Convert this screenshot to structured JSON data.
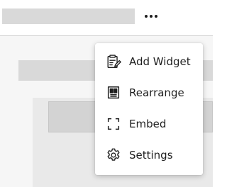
{
  "menu": {
    "items": [
      {
        "label": "Add Widget",
        "icon": "add-widget-icon"
      },
      {
        "label": "Rearrange",
        "icon": "rearrange-icon"
      },
      {
        "label": "Embed",
        "icon": "embed-icon"
      },
      {
        "label": "Settings",
        "icon": "settings-icon"
      }
    ]
  },
  "header": {
    "more_icon": "more-horizontal-icon"
  },
  "colors": {
    "text": "#1f1f1f",
    "placeholder": "#d9d9d9",
    "menu_background": "#ffffff"
  }
}
